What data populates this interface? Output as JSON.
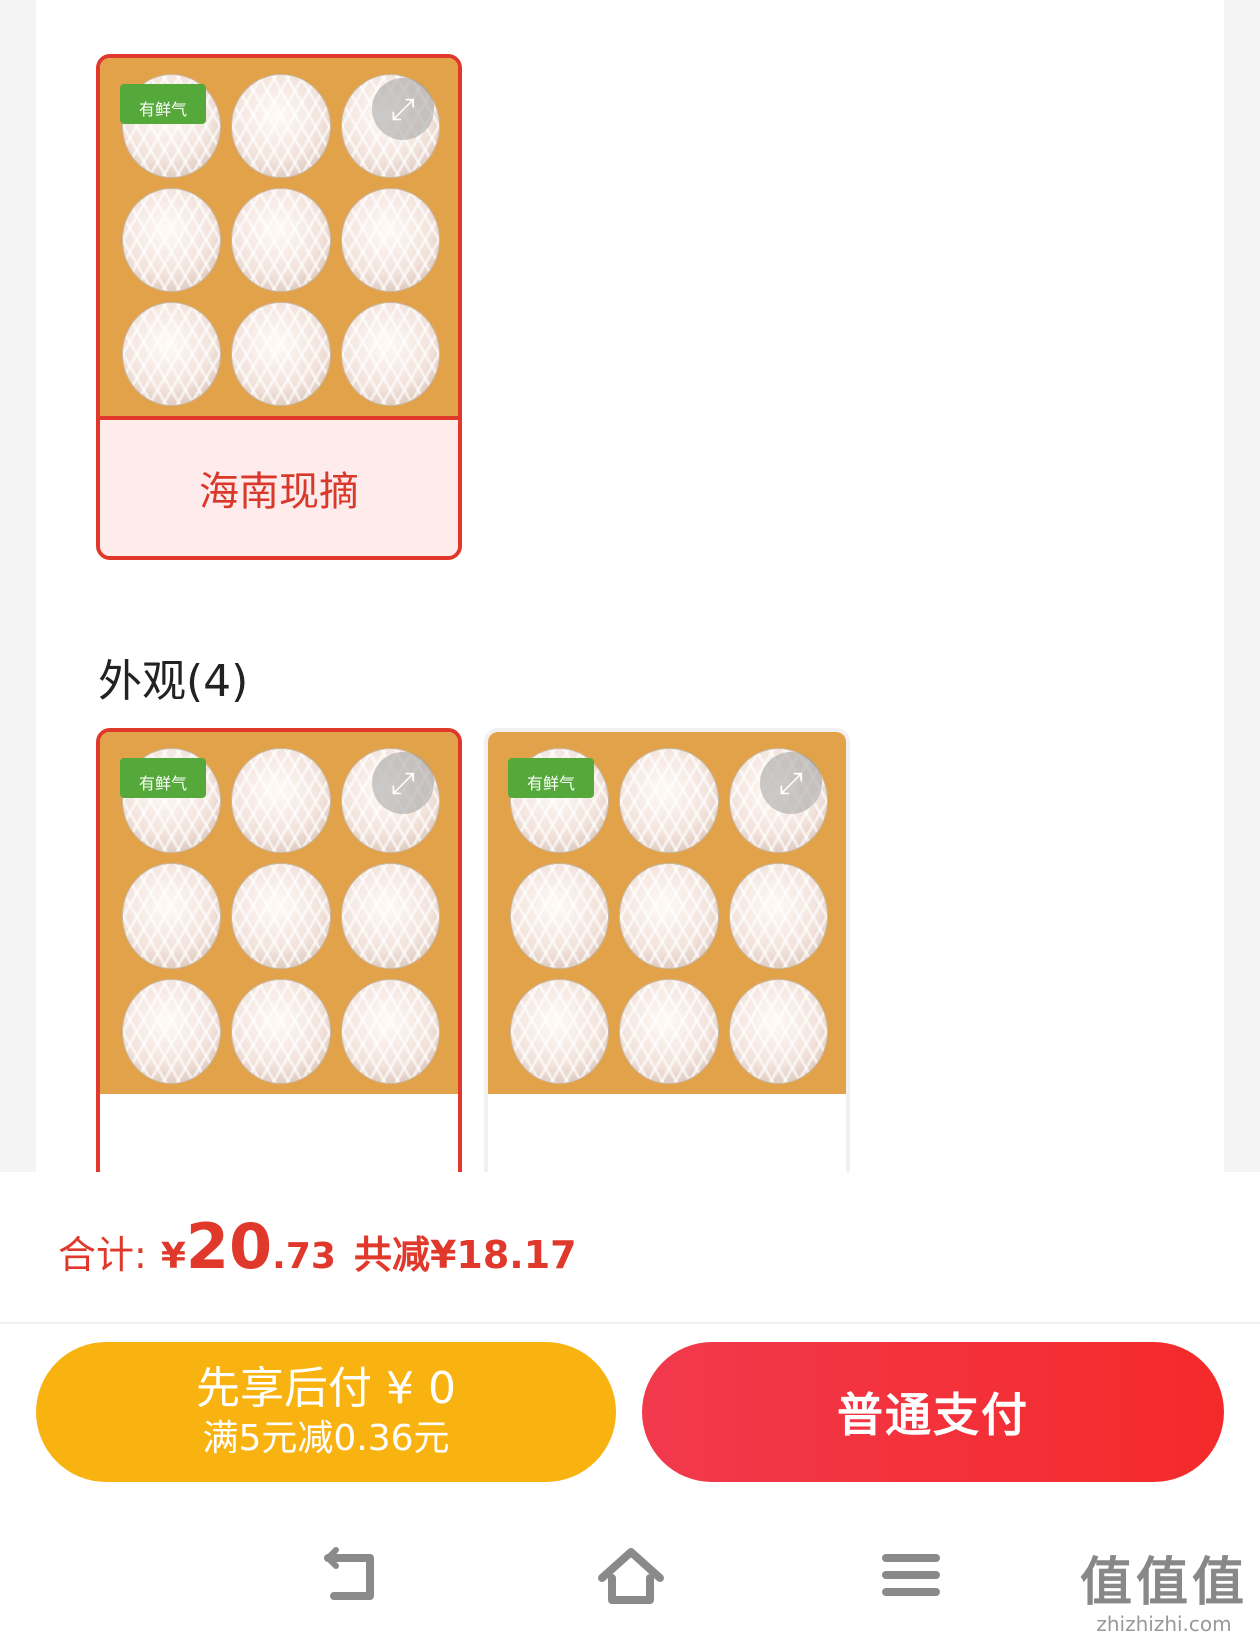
{
  "variants_top": [
    {
      "label": "海南现摘",
      "brand": "有鲜气",
      "selected": true
    }
  ],
  "appearance_section": {
    "title": "外观(4)",
    "items": [
      {
        "brand": "有鲜气",
        "selected": true
      },
      {
        "brand": "有鲜气",
        "selected": false
      }
    ]
  },
  "footer": {
    "total_label": "合计:",
    "currency": "¥",
    "price_int": "20",
    "price_dec": ".73",
    "discount": "共减¥18.17",
    "pay_later": {
      "line1": "先享后付 ¥ 0",
      "line2": "满5元减0.36元"
    },
    "pay_normal": "普通支付"
  },
  "nav": {
    "back": "back-icon",
    "home": "home-icon",
    "menu": "menu-icon"
  },
  "watermark": {
    "big": "值值值",
    "small": "zhizhizhi.com"
  },
  "colors": {
    "accent": "#e0392b",
    "pay_later": "#f9b311",
    "pay_normal": "#f2394d",
    "brand_tag": "#55a93a"
  }
}
